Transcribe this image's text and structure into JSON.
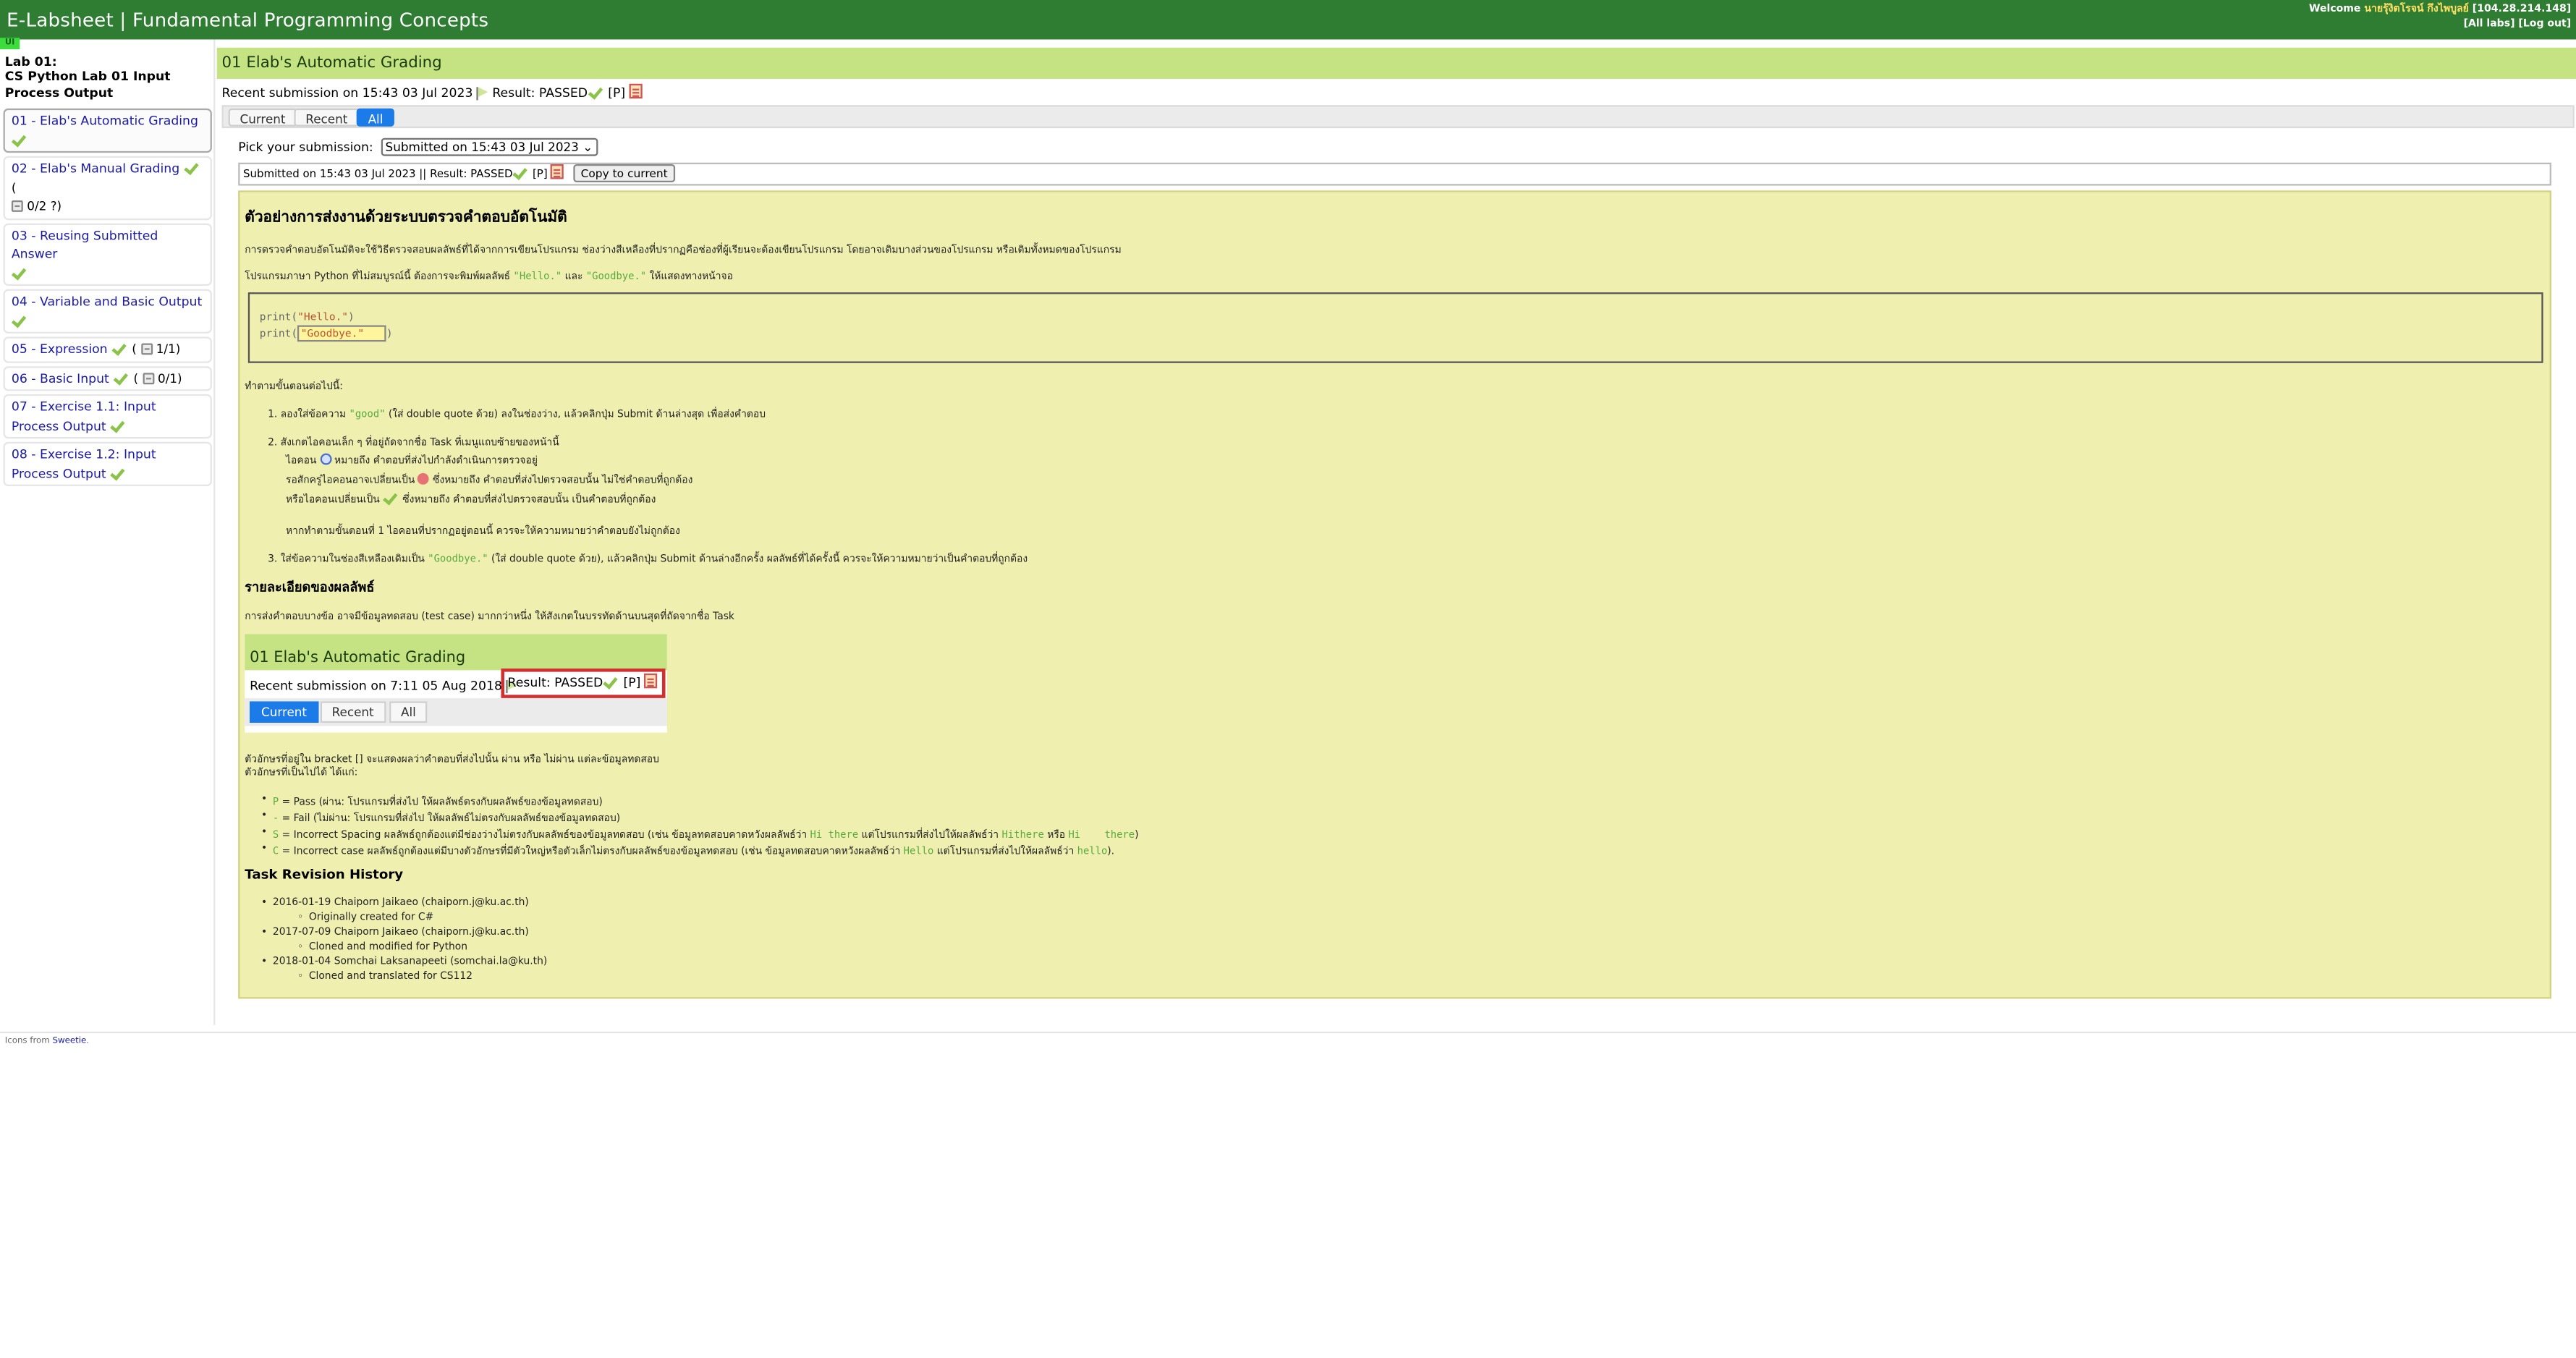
{
  "header": {
    "title": "E-Labsheet | Fundamental Programming Concepts",
    "welcome_label": "Welcome",
    "user_name": "นายรุ้งิตโรจน์ กึงไพบูลย์",
    "ip": "[104.28.214.148]",
    "all_labs": "[All labs]",
    "logout": "[Log out]"
  },
  "sidebar": {
    "lab_number": "Lab 01:",
    "lab_name": "CS Python Lab 01 Input Process Output",
    "tasks": [
      {
        "label": "01 - Elab's Automatic Grading",
        "extra": ""
      },
      {
        "label": "02 - Elab's Manual Grading",
        "extra": "0/2 ?)"
      },
      {
        "label": "03 - Reusing Submitted Answer",
        "extra": ""
      },
      {
        "label": "04 - Variable and Basic Output",
        "extra": ""
      },
      {
        "label": "05 - Expression",
        "extra": "1/1)"
      },
      {
        "label": "06 - Basic Input",
        "extra": "0/1)"
      },
      {
        "label": "07 - Exercise 1.1: Input Process Output",
        "extra": ""
      },
      {
        "label": "08 - Exercise 1.2: Input Process Output",
        "extra": ""
      }
    ]
  },
  "main": {
    "title": "01 Elab's Automatic Grading",
    "recent_submission": "Recent submission on 15:43 03 Jul 2023",
    "result_label": "Result: PASSED",
    "result_code": "[P]",
    "tabs": [
      "Current",
      "Recent",
      "All"
    ],
    "pick_label": "Pick your submission:",
    "pick_value": "Submitted on 15:43 03 Jul 2023",
    "submitted_line": "Submitted on 15:43 03 Jul 2023 || Result: PASSED",
    "copy_button": "Copy to current"
  },
  "content": {
    "heading": "ตัวอย่างการส่งงานด้วยระบบตรวจคำตอบอัตโนมัติ",
    "intro": "การตรวจคำตอบอัตโนมัติจะใช้วิธีตรวจสอบผลลัพธ์ที่ได้จากการเขียนโปรแกรม ช่องว่างสีเหลืองที่ปรากฏคือช่องที่ผู้เรียนจะต้องเขียนโปรแกรม โดยอาจเติมบางส่วนของโปรแกรม หรือเติมทั้งหมดของโปรแกรม",
    "program_pre": "โปรแกรมภาษา Python ที่ไม่สมบูรณ์นี้ ต้องการจะพิมพ์ผลลัพธ์",
    "program_hello": "\"Hello.\"",
    "program_and": "และ",
    "program_goodbye": "\"Goodbye.\"",
    "program_post": "ให้แสดงทางหน้าจอ",
    "code_line1_pre": "print(",
    "code_line1_str": "\"Hello.\"",
    "code_line1_post": ")",
    "code_line2_pre": "print(",
    "code_line2_str": "\"Goodbye.\"",
    "code_line2_post": ")",
    "steps_intro": "ทำตามขั้นตอนต่อไปนี้:",
    "step1_pre": "1. ลองใส่ข้อความ",
    "step1_code": "\"good\"",
    "step1_post": "(ใส่ double quote ด้วย) ลงในช่องว่าง, แล้วคลิกปุ่ม Submit ด้านล่างสุด เพื่อส่งคำตอบ",
    "step2": "2. สังเกตไอคอนเล็ก ๆ ที่อยู่ถัดจากชื่อ Task ที่เมนูแถบซ้ายของหน้านี้",
    "step2_a_pre": "ไอคอน",
    "step2_a_post": "หมายถึง คำตอบที่ส่งไปกำลังดำเนินการตรวจอยู่",
    "step2_b_pre": "รอสักครู่ไอคอนอาจเปลี่ยนเป็น",
    "step2_b_post": "ซึ่งหมายถึง คำตอบที่ส่งไปตรวจสอบนั้น ไม่ใช่คำตอบที่ถูกต้อง",
    "step2_c_pre": "หรือไอคอนเปลี่ยนเป็น",
    "step2_c_post": "ซึ่งหมายถึง คำตอบที่ส่งไปตรวจสอบนั้น เป็นคำตอบที่ถูกต้อง",
    "step2_d": "หากทำตามขั้นตอนที่ 1 ไอคอนที่ปรากฏอยู่ตอนนี้ ควรจะให้ความหมายว่าคำตอบยังไม่ถูกต้อง",
    "step3_pre": "3. ใส่ข้อความในช่องสีเหลืองเดิมเป็น",
    "step3_code": "\"Goodbye.\"",
    "step3_post": "(ใส่ double quote ด้วย), แล้วคลิกปุ่ม Submit ด้านล่างอีกครั้ง ผลลัพธ์ที่ได้ครั้งนี้ ควรจะให้ความหมายว่าเป็นคำตอบที่ถูกต้อง",
    "details_heading": "รายละเอียดของผลลัพธ์",
    "details_text": "การส่งคำตอบบางข้อ อาจมีข้อมูลทดสอบ (test case) มากกว่าหนึ่ง ให้สังเกตในบรรทัดด้านบนสุดที่ถัดจากชื่อ Task",
    "sample": {
      "title": "01 Elab's Automatic Grading",
      "recent": "Recent submission on 7:11 05 Aug 2018",
      "result": "Result: PASSED",
      "code": "[P]",
      "tabs": [
        "Current",
        "Recent",
        "All"
      ]
    },
    "bracket_note1": "ตัวอักษรที่อยู่ใน bracket [] จะแสดงผลว่าคำตอบที่ส่งไปนั้น ผ่าน หรือ ไม่ผ่าน แต่ละข้อมูลทดสอบ",
    "bracket_note2": "ตัวอักษรที่เป็นไปได้ ได้แก่:",
    "legend_p_code": "P",
    "legend_p": "= Pass (ผ่าน: โปรแกรมที่ส่งไป ให้ผลลัพธ์ตรงกับผลลัพธ์ของข้อมูลทดสอบ)",
    "legend_f_code": "-",
    "legend_f": "= Fail (ไม่ผ่าน: โปรแกรมที่ส่งไป ให้ผลลัพธ์ไม่ตรงกับผลลัพธ์ของข้อมูลทดสอบ)",
    "legend_s_code": "S",
    "legend_s_pre": "= Incorrect Spacing ผลลัพธ์ถูกต้องแต่มีช่องว่างไม่ตรงกับผลลัพธ์ของข้อมูลทดสอบ (เช่น ข้อมูลทดสอบคาดหวังผลลัพธ์ว่า",
    "legend_s_ex1": "Hi there",
    "legend_s_mid": "แต่โปรแกรมที่ส่งไปให้ผลลัพธ์ว่า",
    "legend_s_ex2": "Hithere",
    "legend_s_or": "หรือ",
    "legend_s_ex3": "Hi    there",
    "legend_s_end": ")",
    "legend_c_code": "C",
    "legend_c_pre": "= Incorrect case ผลลัพธ์ถูกต้องแต่มีบางตัวอักษรที่มีตัวใหญ่หรือตัวเล็กไม่ตรงกับผลลัพธ์ของข้อมูลทดสอบ (เช่น ข้อมูลทดสอบคาดหวังผลลัพธ์ว่า",
    "legend_c_ex1": "Hello",
    "legend_c_mid": "แต่โปรแกรมที่ส่งไปให้ผลลัพธ์ว่า",
    "legend_c_ex2": "hello",
    "legend_c_end": ").",
    "history_heading": "Task Revision History",
    "history": [
      {
        "entry": "2016-01-19 Chaiporn Jaikaeo (chaiporn.j@ku.ac.th)",
        "note": "Originally created for C#"
      },
      {
        "entry": "2017-07-09 Chaiporn Jaikaeo (chaiporn.j@ku.ac.th)",
        "note": "Cloned and modified for Python"
      },
      {
        "entry": "2018-01-04 Somchai Laksanapeeti (somchai.la@ku.th)",
        "note": "Cloned and translated for CS112"
      }
    ]
  },
  "footer": {
    "text": "Icons from",
    "link": "Sweetie",
    "dot": "."
  },
  "colors": {
    "header_bg": "#2e7d32",
    "title_band": "#c5e383",
    "content_bg": "#efefb0",
    "active_tab": "#1b7be9",
    "check": "#8bc34a"
  }
}
